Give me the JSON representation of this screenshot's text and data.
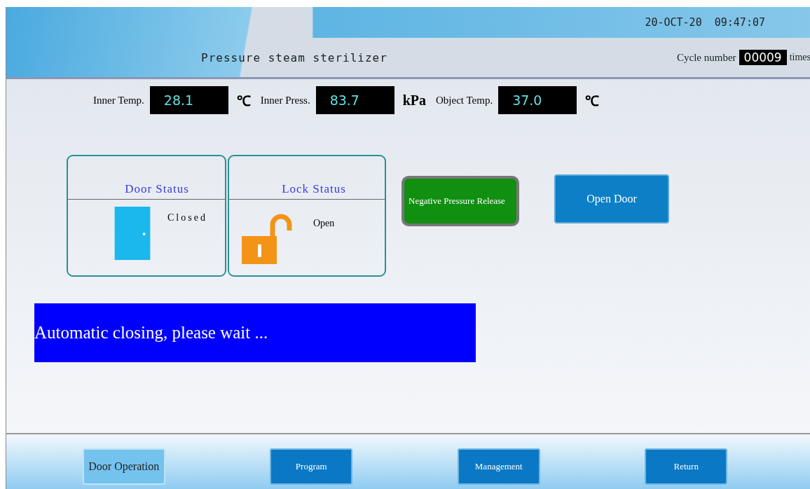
{
  "header": {
    "title": "Pressure steam sterilizer",
    "datetime": "20-OCT-20  09:47:07",
    "cycle_label": "Cycle number",
    "cycle_value": "00009",
    "cycle_unit": "times"
  },
  "readings": [
    {
      "label": "Inner Temp.",
      "value": "28.1",
      "unit": "℃"
    },
    {
      "label": "Inner Press.",
      "value": "83.7",
      "unit": "kPa"
    },
    {
      "label": "Object Temp.",
      "value": "37.0",
      "unit": "℃"
    }
  ],
  "status_panels": [
    {
      "kind": "door",
      "title": "Door Status",
      "state": "Closed"
    },
    {
      "kind": "lock",
      "title": "Lock Status",
      "state": "Open"
    }
  ],
  "negative_pressure_button": "Negative Pressure Release",
  "open_door_button": "Open Door",
  "message": "Automatic closing, please wait ...",
  "nav": [
    {
      "label": "Door Operation",
      "selected": true
    },
    {
      "label": "Program",
      "selected": false
    },
    {
      "label": "Management",
      "selected": false
    },
    {
      "label": "Return",
      "selected": false
    }
  ]
}
